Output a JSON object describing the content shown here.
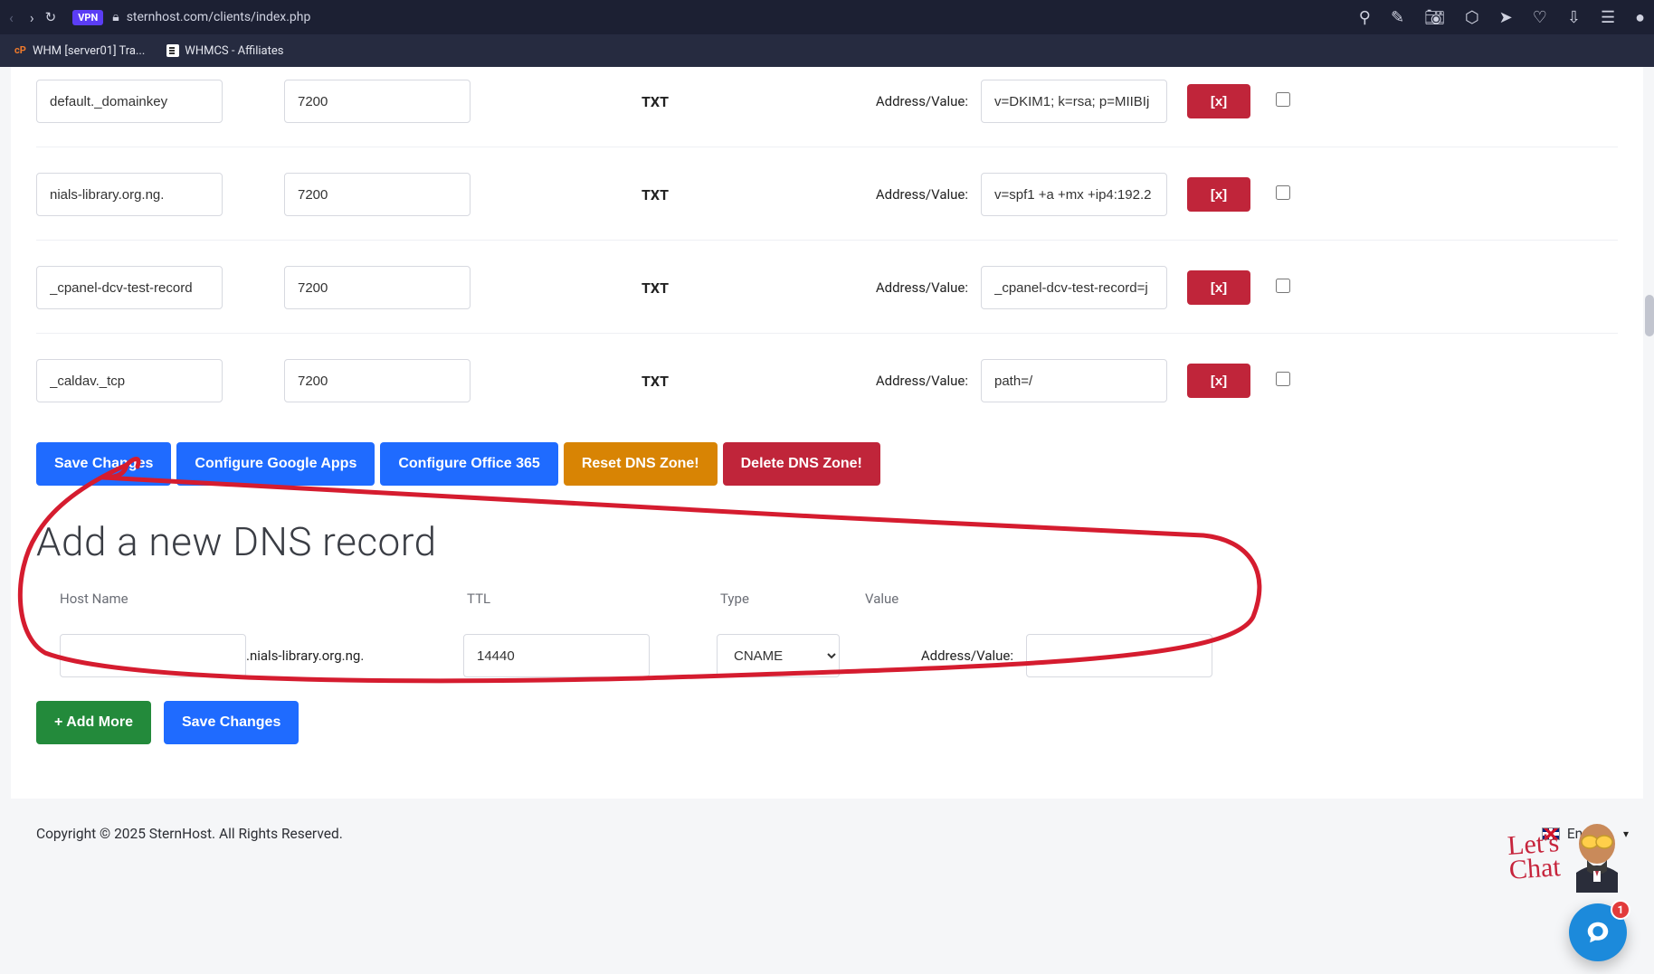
{
  "browser": {
    "url": "sternhost.com/clients/index.php",
    "vpn": "VPN"
  },
  "tabs": [
    {
      "label": "WHM [server01] Tra..."
    },
    {
      "label": "WHMCS - Affiliates"
    }
  ],
  "dns_rows": [
    {
      "host": "default._domainkey",
      "ttl": "7200",
      "type": "TXT",
      "label": "Address/Value:",
      "value": "v=DKIM1; k=rsa; p=MIIBIj",
      "del": "[x]"
    },
    {
      "host": "nials-library.org.ng.",
      "ttl": "7200",
      "type": "TXT",
      "label": "Address/Value:",
      "value": "v=spf1 +a +mx +ip4:192.2",
      "del": "[x]"
    },
    {
      "host": "_cpanel-dcv-test-record",
      "ttl": "7200",
      "type": "TXT",
      "label": "Address/Value:",
      "value": "_cpanel-dcv-test-record=j",
      "del": "[x]"
    },
    {
      "host": "_caldav._tcp",
      "ttl": "7200",
      "type": "TXT",
      "label": "Address/Value:",
      "value": "path=/",
      "del": "[x]"
    }
  ],
  "actions": {
    "save": "Save Changes",
    "google": "Configure Google Apps",
    "o365": "Configure Office 365",
    "reset": "Reset DNS Zone!",
    "delete": "Delete DNS Zone!"
  },
  "add": {
    "title": "Add a new DNS record",
    "headers": {
      "host": "Host Name",
      "ttl": "TTL",
      "type": "Type",
      "value": "Value"
    },
    "row": {
      "host": "",
      "suffix": ".nials-library.org.ng.",
      "ttl": "14440",
      "type": "CNAME",
      "label": "Address/Value:",
      "value": ""
    },
    "buttons": {
      "add_more": "+ Add More",
      "save": "Save Changes"
    }
  },
  "footer": {
    "copyright": "Copyright © 2025 SternHost. All Rights Reserved.",
    "lang": "English"
  },
  "chat": {
    "text_line1": "Let's",
    "text_line2": "Chat",
    "badge": "1"
  }
}
